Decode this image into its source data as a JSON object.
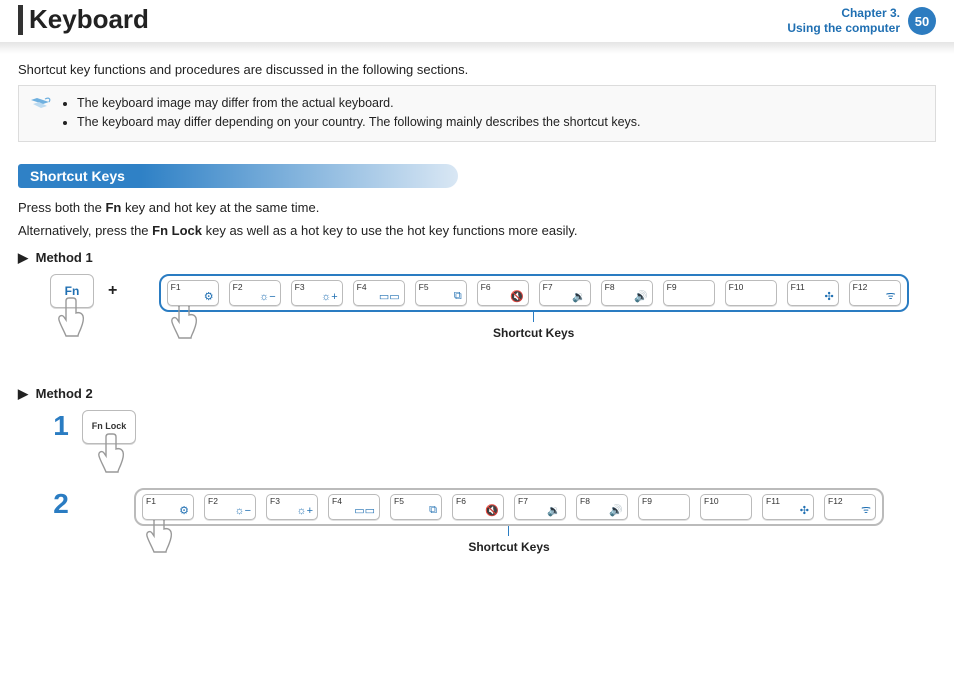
{
  "header": {
    "title": "Keyboard",
    "chapter_line1": "Chapter 3.",
    "chapter_line2": "Using the computer",
    "page_number": "50"
  },
  "intro": "Shortcut key functions and procedures are discussed in the following sections.",
  "note": {
    "items": [
      "The keyboard image may differ from the actual keyboard.",
      "The keyboard may differ depending on your country. The following mainly describes the shortcut keys."
    ]
  },
  "section": {
    "shortcut_keys_heading": "Shortcut Keys",
    "line1_pre": "Press both the ",
    "line1_bold": "Fn",
    "line1_post": " key and hot key at the same time.",
    "line2_pre": "Alternatively, press the ",
    "line2_bold": "Fn Lock",
    "line2_post": " key as well as a hot key to use the hot key functions more easily."
  },
  "methods": {
    "arrow": "▶",
    "method1_label": "Method 1",
    "method2_label": "Method 2",
    "plus": "+",
    "fn_label": "Fn",
    "fnlock_label": "Fn Lock",
    "step1": "1",
    "step2": "2",
    "shortcut_caption": "Shortcut Keys",
    "fkeys": [
      {
        "label": "F1",
        "icon": "⚙"
      },
      {
        "label": "F2",
        "icon": "☼−"
      },
      {
        "label": "F3",
        "icon": "☼+"
      },
      {
        "label": "F4",
        "icon": "▭▭"
      },
      {
        "label": "F5",
        "icon": "⧉"
      },
      {
        "label": "F6",
        "icon": "🔇"
      },
      {
        "label": "F7",
        "icon": "🔉"
      },
      {
        "label": "F8",
        "icon": "🔊"
      },
      {
        "label": "F9",
        "icon": ""
      },
      {
        "label": "F10",
        "icon": ""
      },
      {
        "label": "F11",
        "icon": "✣"
      },
      {
        "label": "F12",
        "icon": "ᯤ"
      }
    ]
  }
}
